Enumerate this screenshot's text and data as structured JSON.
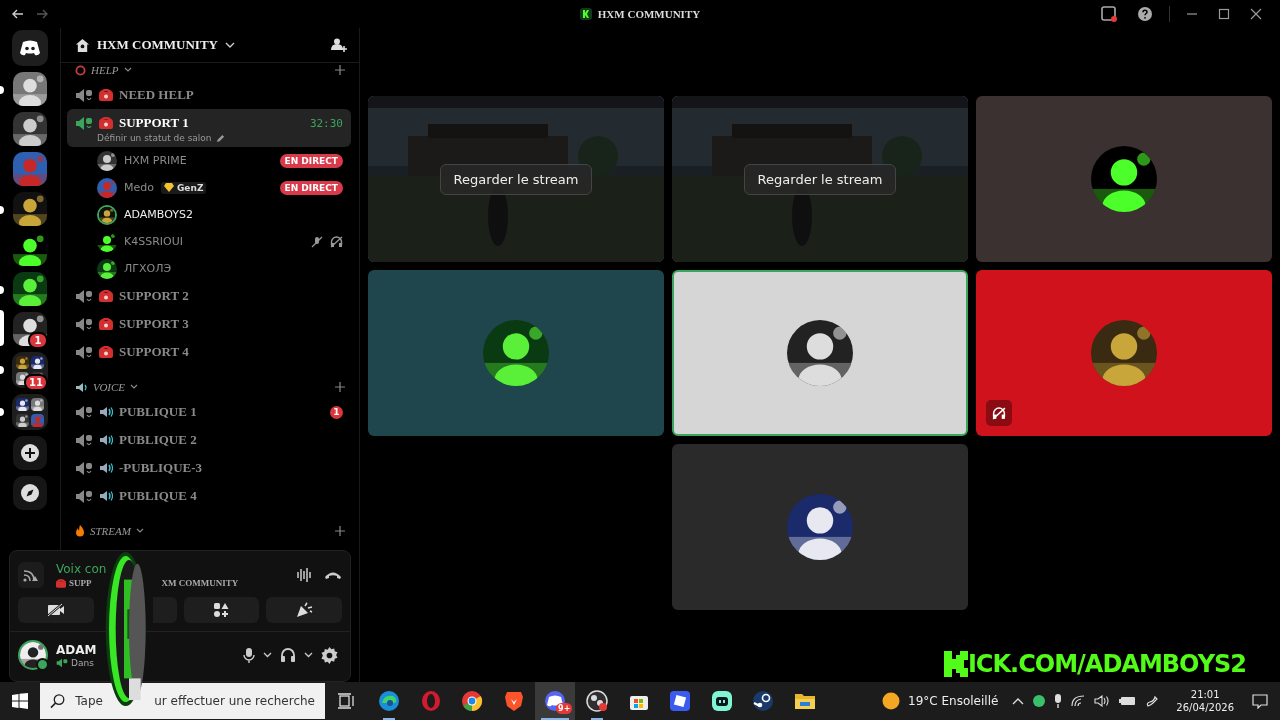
{
  "window": {
    "title": "HXM COMMUNITY"
  },
  "servers": [
    {
      "kind": "home",
      "selected": false,
      "unread": false
    },
    {
      "kind": "server",
      "selected": false,
      "unread": true
    },
    {
      "kind": "server",
      "selected": false,
      "unread": false
    },
    {
      "kind": "server",
      "selected": false,
      "unread": false
    },
    {
      "kind": "server",
      "selected": false,
      "unread": true
    },
    {
      "kind": "server",
      "selected": false,
      "unread": false
    },
    {
      "kind": "server",
      "selected": false,
      "unread": true
    },
    {
      "kind": "server",
      "selected": true,
      "badge": "1"
    },
    {
      "kind": "folder",
      "selected": false,
      "unread": true,
      "badge": "11"
    },
    {
      "kind": "folder",
      "selected": false,
      "unread": true
    },
    {
      "kind": "add"
    },
    {
      "kind": "discover"
    }
  ],
  "guild": {
    "name": "HXM COMMUNITY"
  },
  "categories": [
    {
      "name": "HELP",
      "kind": "help",
      "channels": [
        {
          "name": "NEED HELP",
          "kind": "phone",
          "selected": false
        },
        {
          "name": "SUPPORT 1",
          "kind": "phone",
          "selected": true,
          "timer": "32:30",
          "status": "Définir un statut de salon",
          "members": [
            {
              "name": "HXM PRIME",
              "speaking": false,
              "live": "EN DIRECT",
              "muted": false,
              "deafened": false
            },
            {
              "name": "Medo",
              "tag": "GenZ",
              "speaking": false,
              "live": "EN DIRECT",
              "muted": false,
              "deafened": false
            },
            {
              "name": "ADAMBOYS2",
              "speaking": true,
              "muted": false,
              "deafened": false
            },
            {
              "name": "K4SSRIOUI",
              "speaking": false,
              "muted": true,
              "deafened": true
            },
            {
              "name": "ЛГХОЛЭ",
              "speaking": false,
              "muted": false,
              "deafened": false
            }
          ]
        },
        {
          "name": "SUPPORT 2",
          "kind": "phone",
          "selected": false
        },
        {
          "name": "SUPPORT 3",
          "kind": "phone",
          "selected": false
        },
        {
          "name": "SUPPORT 4",
          "kind": "phone",
          "selected": false
        }
      ]
    },
    {
      "name": "VOICE",
      "kind": "voice",
      "channels": [
        {
          "name": "PUBLIQUE 1",
          "kind": "speaker",
          "selected": false,
          "badge": "1"
        },
        {
          "name": "PUBLIQUE 2",
          "kind": "speaker",
          "selected": false
        },
        {
          "name": "-PUBLIQUE-3",
          "kind": "speaker",
          "selected": false
        },
        {
          "name": "PUBLIQUE 4",
          "kind": "speaker",
          "selected": false
        }
      ]
    },
    {
      "name": "STREAM",
      "kind": "stream"
    }
  ],
  "voice_panel": {
    "status": "Voix con",
    "channel_start": "SUPP",
    "channel_end": "XM COMMUNITY"
  },
  "user_panel": {
    "name": "ADAM",
    "status": "Dans"
  },
  "tiles": [
    {
      "kind": "stream",
      "action": "Regarder le stream",
      "speaking": false,
      "deafened": false
    },
    {
      "kind": "stream",
      "action": "Regarder le stream",
      "speaking": false,
      "deafened": false
    },
    {
      "kind": "avatar",
      "color": "#3b3130",
      "speaking": false,
      "deafened": false
    },
    {
      "kind": "avatar",
      "color": "#1f464c",
      "speaking": false,
      "deafened": false
    },
    {
      "kind": "avatar",
      "color": "#d6d6d6",
      "speaking": true,
      "deafened": false
    },
    {
      "kind": "avatar",
      "color": "#d0121c",
      "speaking": false,
      "deafened": true
    },
    {
      "kind": "avatar",
      "color": "#2a2a2a",
      "speaking": false,
      "deafened": false
    }
  ],
  "overlay_text": "ICK.COM/ADAMBOYS2",
  "taskbar": {
    "search_start": "Tape",
    "search_end": "ur effectuer une recherche",
    "apps": [
      {
        "kind": "edge",
        "running": true,
        "selected": false
      },
      {
        "kind": "opera",
        "running": false,
        "selected": false
      },
      {
        "kind": "chrome",
        "running": false,
        "selected": false
      },
      {
        "kind": "brave",
        "running": false,
        "selected": false
      },
      {
        "kind": "discord",
        "running": true,
        "selected": true,
        "badge": "9+"
      },
      {
        "kind": "obs",
        "running": true,
        "selected": false
      },
      {
        "kind": "store",
        "running": false,
        "selected": false
      },
      {
        "kind": "roblox",
        "running": false,
        "selected": false
      },
      {
        "kind": "streamlabs",
        "running": false,
        "selected": false
      },
      {
        "kind": "steam",
        "running": false,
        "selected": false
      },
      {
        "kind": "files",
        "running": false,
        "selected": false
      }
    ],
    "weather": "19°C Ensoleillé",
    "time": "21:01",
    "date": "26/04/2026"
  }
}
